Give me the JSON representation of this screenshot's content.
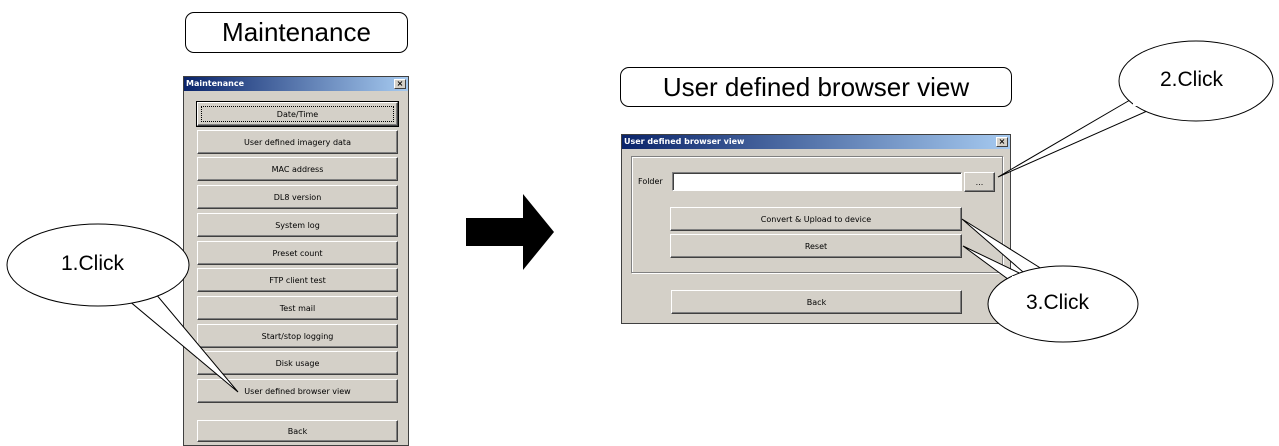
{
  "labels": {
    "maintenance": "Maintenance",
    "browser_view": "User defined browser view"
  },
  "maintenance_window": {
    "title": "Maintenance",
    "close_label": "×",
    "buttons": [
      "Date/Time",
      "User defined imagery data",
      "MAC address",
      "DL8 version",
      "System log",
      "Preset count",
      "FTP client test",
      "Test mail",
      "Start/stop logging",
      "Disk usage",
      "User defined browser view"
    ],
    "back_label": "Back"
  },
  "browser_window": {
    "title": "User defined browser view",
    "close_label": "×",
    "folder_label": "Folder",
    "folder_value": "",
    "browse_label": "...",
    "convert_label": "Convert & Upload to device",
    "reset_label": "Reset",
    "back_label": "Back"
  },
  "callouts": {
    "step1": "1.Click",
    "step2": "2.Click",
    "step3": "3.Click"
  }
}
